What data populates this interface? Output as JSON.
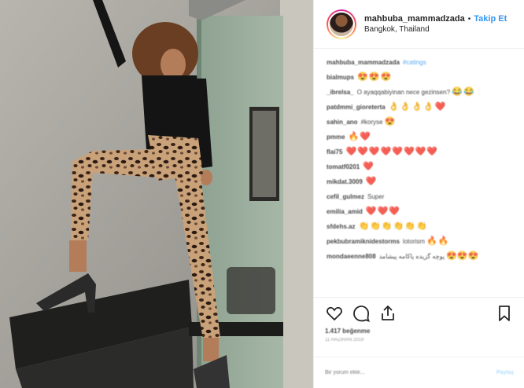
{
  "post": {
    "username": "mahbuba_mammadzada",
    "separator": "•",
    "follow_label": "Takip Et",
    "location": "Bangkok, Thailand"
  },
  "comments": [
    {
      "user": "mahbuba_mammadzada",
      "text": "#catings",
      "emoji": ""
    },
    {
      "user": "bialmups",
      "text": "",
      "emoji": "😍😍😍"
    },
    {
      "user": "_ibrelsa_",
      "text": "O ayaqqabiyinan nece gezinsen?",
      "emoji": "😂😂"
    },
    {
      "user": "patdmmi_gioreterta",
      "text": "",
      "emoji": "👌👌👌👌❤️"
    },
    {
      "user": "sahin_ano",
      "text": "#koryse",
      "emoji": "😍"
    },
    {
      "user": "pmme",
      "text": "",
      "emoji": "🔥❤️"
    },
    {
      "user": "flai75",
      "text": "",
      "emoji": "❤️❤️❤️❤️❤️❤️❤️❤️"
    },
    {
      "user": "tomatf0201",
      "text": "",
      "emoji": "❤️"
    },
    {
      "user": "mikdat.3009",
      "text": "",
      "emoji": "❤️"
    },
    {
      "user": "cefil_gulmez",
      "text": "Super",
      "emoji": ""
    },
    {
      "user": "emilia_amid",
      "text": "",
      "emoji": "❤️❤️❤️"
    },
    {
      "user": "sfdehs.az",
      "text": "",
      "emoji": "👏👏👏👏👏👏"
    },
    {
      "user": "pekbubramiknidestorms",
      "text": "lotorism",
      "emoji": "🔥🔥"
    },
    {
      "user": "mondaeenne808",
      "text": "پوچه گزیده پاکامه پیشامد",
      "emoji": "😍😍😍"
    }
  ],
  "likes_text": "1.417 beğenme",
  "date_text": "11 HAZIRAN 2019",
  "comment_placeholder": "Bir yorum ekle...",
  "post_button": "Paylaş",
  "icons": {
    "like": "heart-icon",
    "comment": "comment-icon",
    "share": "share-icon",
    "save": "bookmark-icon"
  },
  "colors": {
    "accent": "#3897f0",
    "text": "#262626",
    "border": "#efefef"
  }
}
